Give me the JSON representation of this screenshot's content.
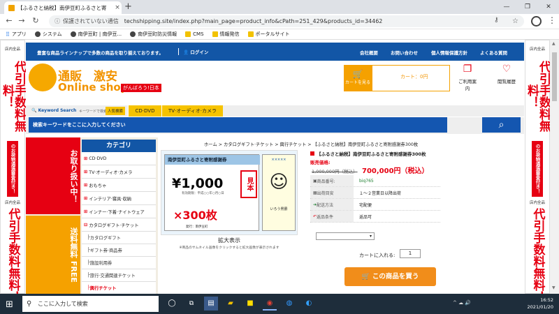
{
  "browser": {
    "tab_title": "【ふるさと納税】南伊豆町ふるさと寄",
    "tab_close": "×",
    "new_tab": "+",
    "win_min": "—",
    "win_max": "❐",
    "win_close": "✕",
    "back": "←",
    "forward": "→",
    "reload": "↻",
    "security": "保護されていない通信",
    "url": "techshipping.site/index.php?main_page=product_info&cPath=251_429&products_id=34462",
    "bookmarks": [
      "アプリ",
      "システム",
      "南伊豆町 | 南伊豆...",
      "南伊豆町防災情報",
      "CMS",
      "情報発信",
      "ポータルサイト"
    ]
  },
  "side": {
    "shop": "店内全品",
    "big": "代引手数料無料！",
    "mid": "のお荷物通過審査付き！",
    "big2": "代引手数料無料！"
  },
  "header": {
    "tagline": "豊富な商品ラインナップで多数の商品を取り揃えております。",
    "login": "ログイン",
    "links": [
      "会社概要",
      "お問い合わせ",
      "個人情報保護方針",
      "よくある質問"
    ],
    "logo_top": "通販　激安",
    "logo_bottom": "Online shop",
    "logo_tag": "がんばろう!日本",
    "cart_button": "カートを見る",
    "cart_total": "カート：0円",
    "guide": "ご利用案内",
    "history": "閲覧履歴"
  },
  "search": {
    "keyword_label": "Keyword Search",
    "keyword_sub": "キーワードで検索する",
    "popular": "人気検索",
    "tabs": [
      "CD·DVD",
      "TV·オーディオ·カメラ"
    ],
    "placeholder": "検索キーワードをここに入力してください",
    "button": "⌕"
  },
  "promo": {
    "left1": "お取り扱い中！",
    "left2": "送料無料 FREE"
  },
  "category": {
    "title": "カテゴリ",
    "items": [
      "CD·DVD",
      "TV·オーディオ·カメラ",
      "おもちゃ",
      "インテリア·寝具·収納",
      "インナー·下着·ナイトウェア",
      "カタログギフト·チケット"
    ],
    "subitems": [
      "カタログギフト",
      "ギフト券·商品券",
      "施設利用券",
      "旅行·交通関連チケット"
    ],
    "more": "興行チケット"
  },
  "product": {
    "breadcrumb": "ホーム > カタログギフト·チケット > 興行チケット > 【ふるさと納税】南伊豆町ふるさと寄附感謝券300枚",
    "voucher_title": "南伊豆町ふるさと寄附感謝券",
    "voucher_value": "¥1,000",
    "voucher_stamp": "見本",
    "voucher_count": "×300枚",
    "voucher_issuer": "発行：南伊豆町",
    "voucher_small": "有効期限：平成○○年○月○日",
    "stub_label": "×××××",
    "stub_mascot": "いろう男爵",
    "zoom": "拡大表示",
    "zoom_note": "※商品のサムネイル画像をクリックすると拡大画像が表示されます",
    "title": "【ふるさと納税】南伊豆町ふるさと寄附感謝券300枚",
    "price_label": "販売価格:",
    "price_old": "1,000,000円（税込）",
    "price_new": "700,000円（税込）",
    "specs": [
      {
        "k": "商品番号:",
        "v": "biq765"
      },
      {
        "k": "出荷目安",
        "v": "１～２営業日以降出荷"
      },
      {
        "k": "配送方法",
        "v": "宅配便"
      },
      {
        "k": "返品条件",
        "v": "返品可"
      }
    ],
    "option": "▾",
    "qty_label": "カートに入れる:",
    "qty": "1",
    "buy": "この商品を買う"
  },
  "taskbar": {
    "start": "⊞",
    "search": "ここに入力して検索",
    "time": "16:52",
    "date": "2021/01/20",
    "tray": "^ ☁ 🔊"
  },
  "colors": {
    "brand_blue": "#1256a6",
    "accent_orange": "#f5a100",
    "red": "#e60012"
  }
}
